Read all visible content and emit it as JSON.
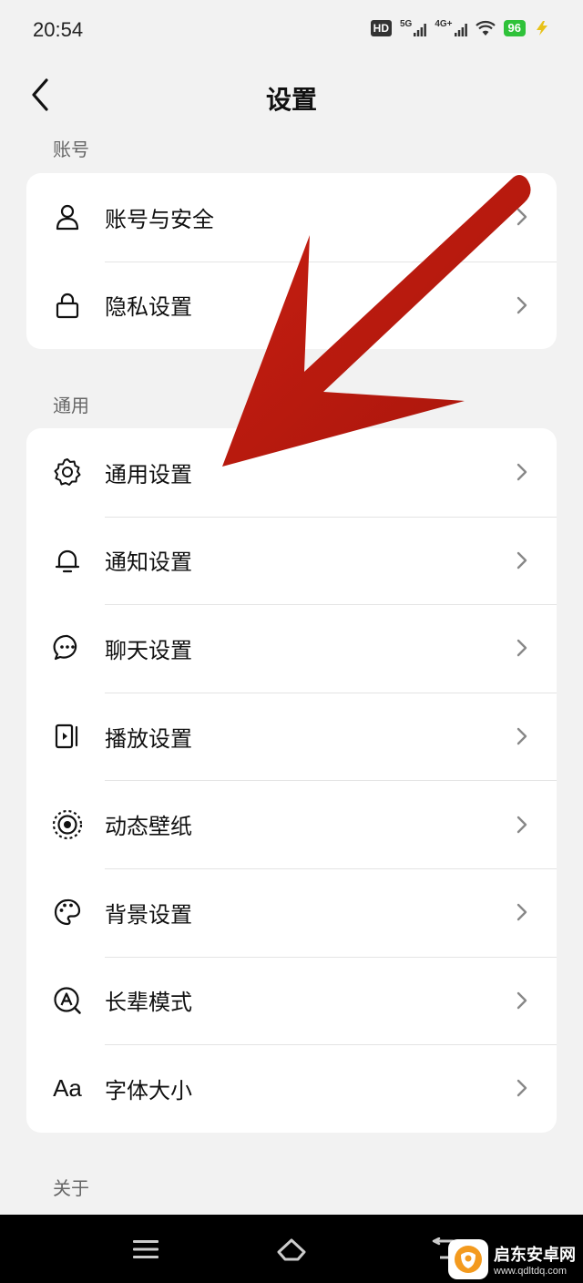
{
  "status_bar": {
    "time": "20:54",
    "hd": "HD",
    "net1": "5G",
    "net2": "4G+",
    "battery": "96"
  },
  "header": {
    "title": "设置"
  },
  "sections": {
    "account": {
      "title": "账号",
      "items": [
        {
          "label": "账号与安全",
          "icon": "user-icon"
        },
        {
          "label": "隐私设置",
          "icon": "lock-icon"
        }
      ]
    },
    "general": {
      "title": "通用",
      "items": [
        {
          "label": "通用设置",
          "icon": "gear-icon"
        },
        {
          "label": "通知设置",
          "icon": "bell-icon"
        },
        {
          "label": "聊天设置",
          "icon": "chat-bubble-icon"
        },
        {
          "label": "播放设置",
          "icon": "play-panel-icon"
        },
        {
          "label": "动态壁纸",
          "icon": "target-rings-icon"
        },
        {
          "label": "背景设置",
          "icon": "palette-icon"
        },
        {
          "label": "长辈模式",
          "icon": "elder-mode-icon"
        },
        {
          "label": "字体大小",
          "icon": "font-size-icon",
          "glyph": "Aa"
        }
      ]
    },
    "about": {
      "title": "关于"
    }
  },
  "watermark": {
    "name": "启东安卓网",
    "url": "www.qdltdq.com"
  },
  "colors": {
    "background": "#f2f2f2",
    "card": "#ffffff",
    "annotation_arrow": "#b8180e",
    "battery": "#2fc23a"
  }
}
